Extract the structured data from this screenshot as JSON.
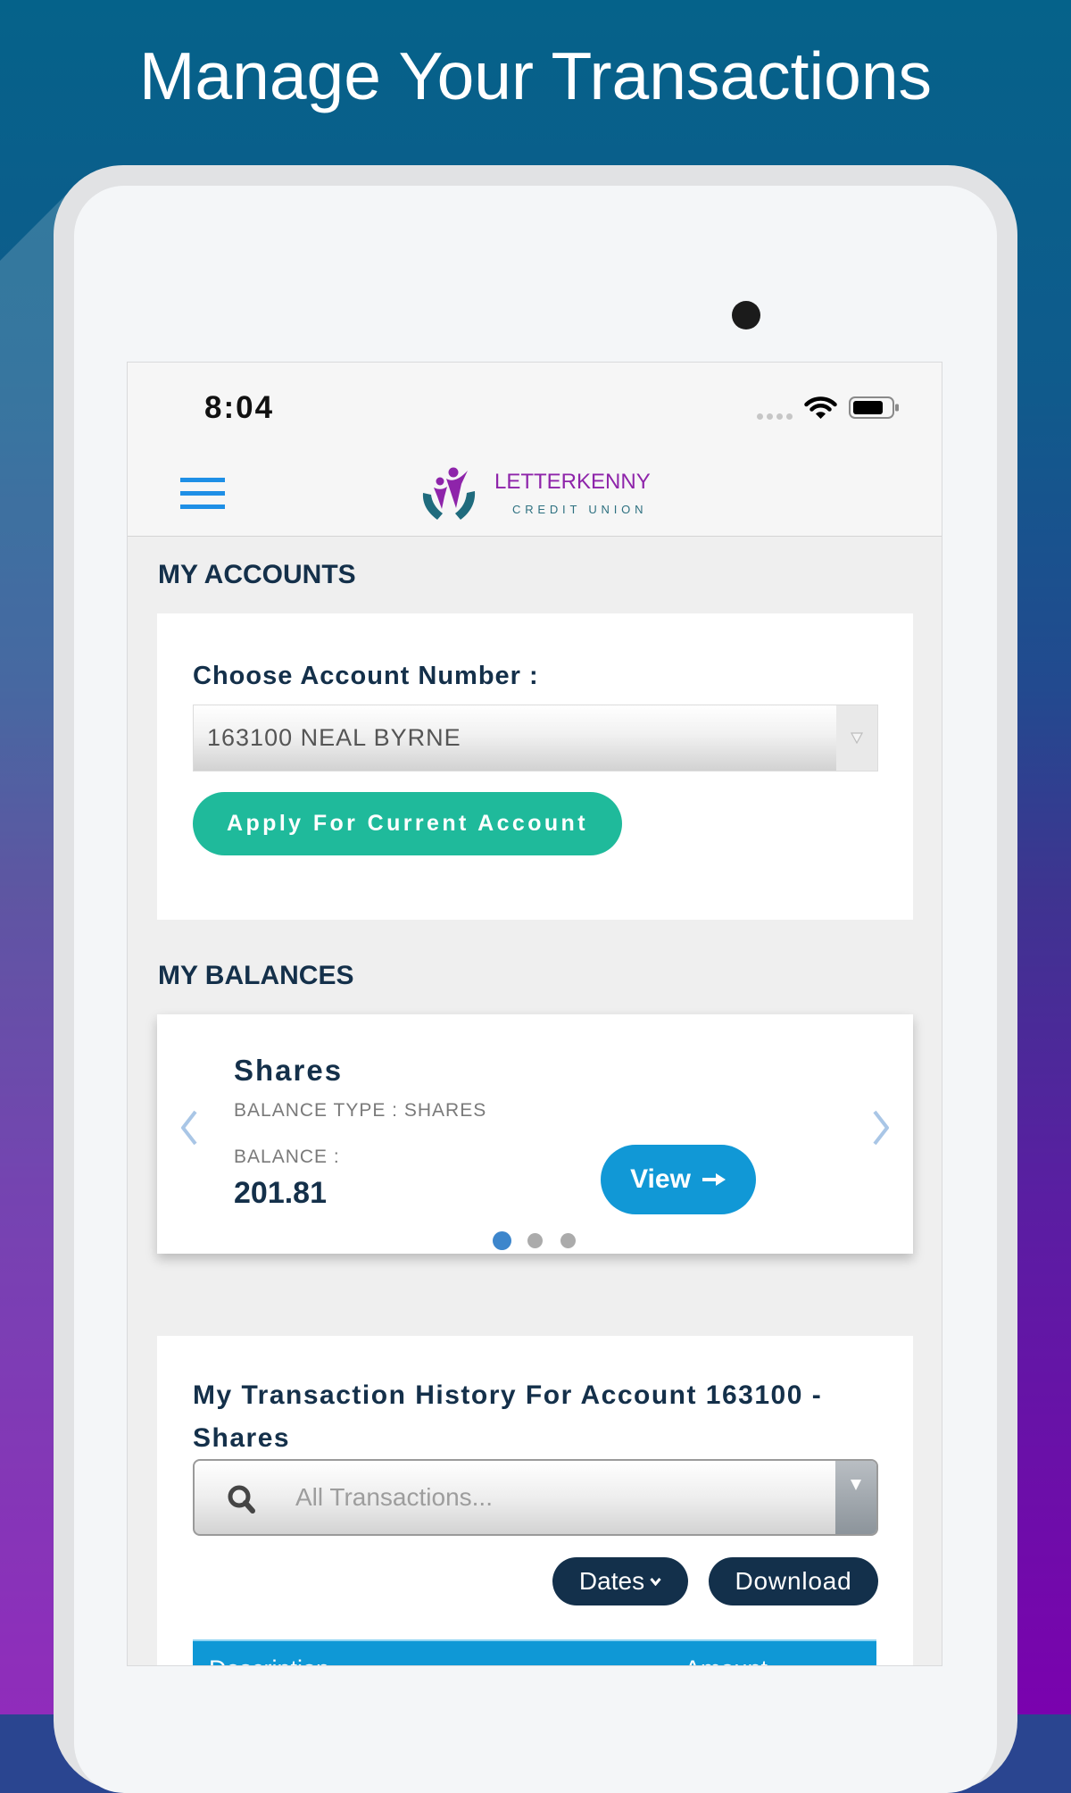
{
  "promo": {
    "headline": "Manage Your Transactions"
  },
  "status_bar": {
    "time": "8:04",
    "icons": [
      "cellular-signal-icon",
      "wifi-icon",
      "battery-icon"
    ]
  },
  "header": {
    "menu_icon": "hamburger-menu-icon",
    "brand_name": "LETTERKENNY",
    "brand_sub": "CREDIT UNION"
  },
  "accounts": {
    "section_title": "MY ACCOUNTS",
    "choose_label": "Choose Account Number :",
    "selected_account": "163100 NEAL BYRNE",
    "apply_button": "Apply For Current Account"
  },
  "balances": {
    "section_title": "MY BALANCES",
    "slides_total": 3,
    "active_slide": 0,
    "current": {
      "name": "Shares",
      "type_label": "BALANCE TYPE : SHARES",
      "balance_label": "BALANCE :",
      "balance_value": "201.81",
      "view_button": "View"
    }
  },
  "transactions": {
    "title": "My Transaction History For Account 163100 - Shares",
    "search_placeholder": "All Transactions...",
    "dates_button": "Dates",
    "download_button": "Download",
    "columns": [
      "Description",
      "Amount"
    ]
  },
  "theme": {
    "navy": "#14304a",
    "teal": "#1fba9b",
    "blue": "#1198d6",
    "table-blue": "#0f98d6",
    "purple": "#8e24aa",
    "brand-teal": "#2d7080",
    "menu-blue": "#1e8fe6",
    "dot-active": "#3d86cc",
    "dot-inactive": "#ababab"
  }
}
